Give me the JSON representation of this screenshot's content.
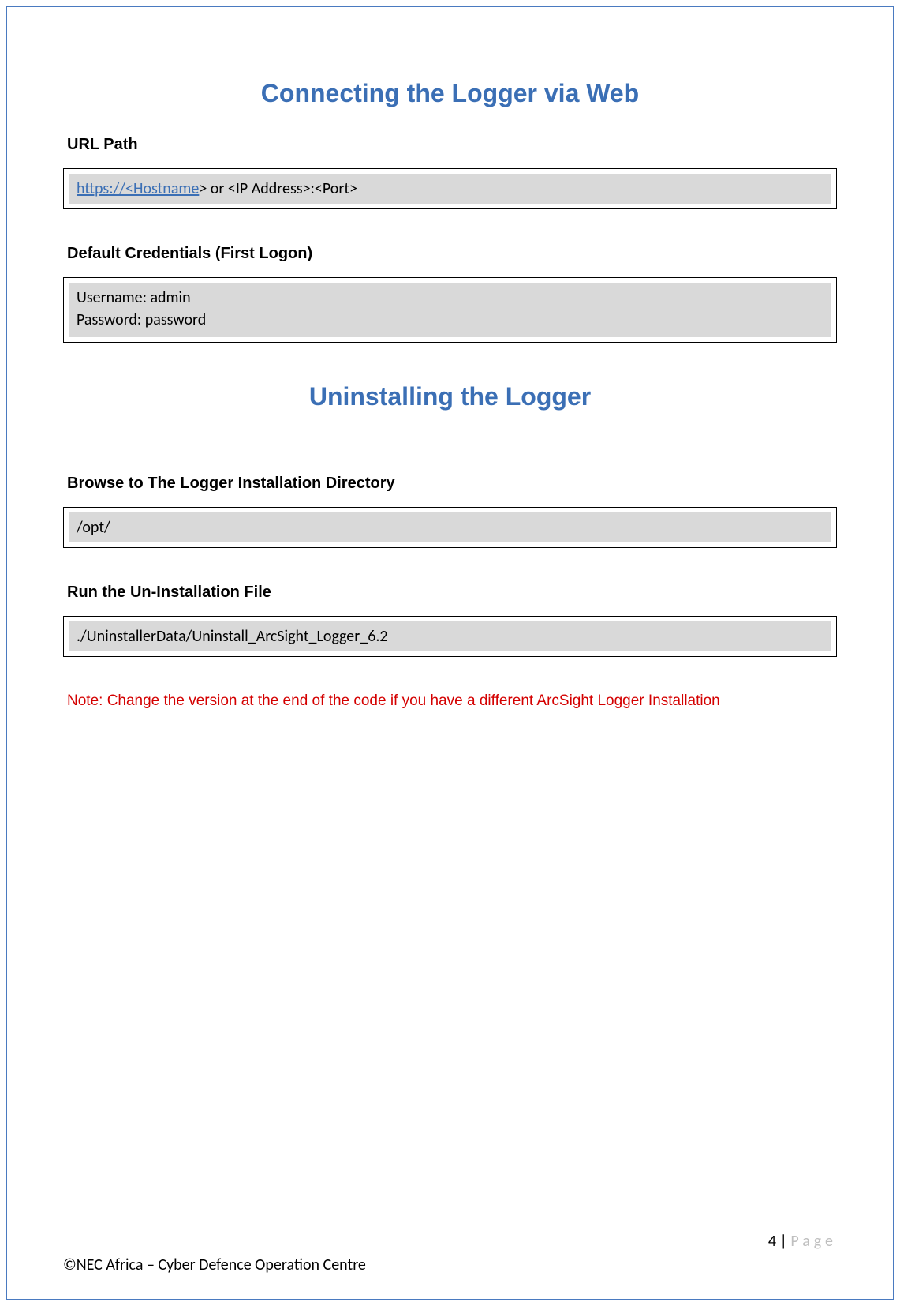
{
  "headings": {
    "connecting": "Connecting the Logger via Web",
    "uninstalling": "Uninstalling the Logger"
  },
  "sections": {
    "url_path": {
      "title": "URL Path",
      "link_prefix": "https://<Hostname",
      "link_suffix": "> or <IP Address>:<Port>"
    },
    "default_creds": {
      "title": "Default Credentials (First Logon)",
      "username_line": "Username: admin",
      "password_line": "Password: password"
    },
    "browse_dir": {
      "title": "Browse to The Logger Installation Directory",
      "code": "/opt/"
    },
    "run_uninstall": {
      "title": "Run the Un-Installation File",
      "code": "./UninstallerData/Uninstall_ArcSight_Logger_6.2"
    },
    "note": "Note: Change the version at the end of the code if you have a different ArcSight Logger Installation"
  },
  "footer": {
    "page_num": "4",
    "page_sep": " | ",
    "page_label": "Page",
    "copyright": "©NEC Africa – Cyber Defence Operation Centre"
  }
}
